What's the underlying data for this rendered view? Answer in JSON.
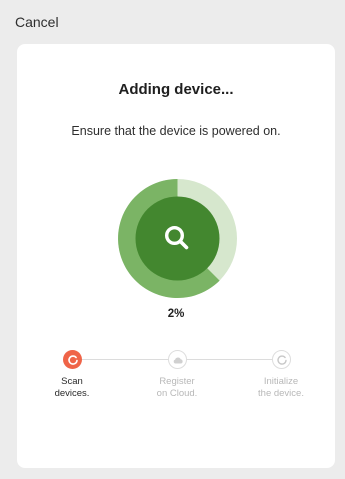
{
  "header": {
    "cancel_label": "Cancel"
  },
  "card": {
    "title": "Adding device...",
    "subtitle": "Ensure that the device is powered on.",
    "progress": {
      "value": 2,
      "label": "2%",
      "icon": "search-icon"
    }
  },
  "steps": [
    {
      "line1": "Scan",
      "line2": "devices.",
      "state": "active",
      "icon": "refresh-icon"
    },
    {
      "line1": "Register",
      "line2": "on Cloud.",
      "state": "inactive",
      "icon": "cloud-icon"
    },
    {
      "line1": "Initialize",
      "line2": "the device.",
      "state": "inactive",
      "icon": "refresh-icon"
    }
  ],
  "colors": {
    "accent": "#ef6448",
    "progress_dark": "#3f8a2b",
    "progress_mid": "#7bb465",
    "progress_light": "#d5e7cc"
  }
}
